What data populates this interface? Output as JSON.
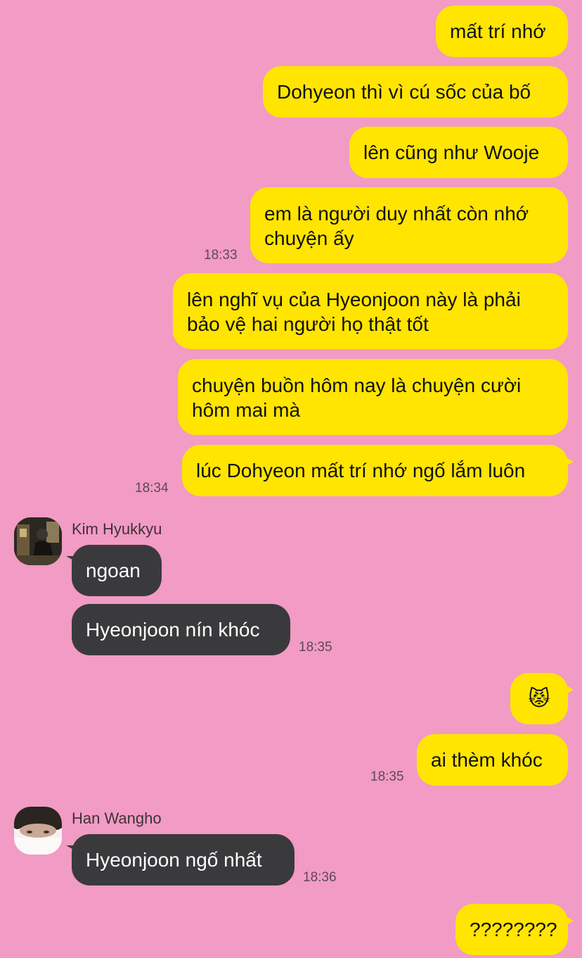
{
  "colors": {
    "background": "#f29bc4",
    "sent_bubble": "#ffe500",
    "received_bubble": "#3a3a3c",
    "timestamp": "#5b4a54"
  },
  "messages": [
    {
      "text": "mất trí nhớ"
    },
    {
      "text": "Dohyeon thì vì cú sốc của bố"
    },
    {
      "text": "lên cũng như Wooje"
    },
    {
      "line1": "em là người duy nhất còn nhớ",
      "line2": "chuyện ấy",
      "time": "18:33"
    },
    {
      "line1": "lên nghĩ vụ của Hyeonjoon này là phải",
      "line2": "bảo vệ hai người họ thật tốt"
    },
    {
      "line1": "chuyện buồn hôm nay là chuyện cười",
      "line2": "hôm mai mà"
    },
    {
      "text": "lúc Dohyeon mất trí nhớ ngố lắm luôn",
      "time": "18:34"
    }
  ],
  "kim": {
    "name": "Kim Hyukkyu",
    "avatar_icon": "profile-photo-dark",
    "msg1": "ngoan",
    "msg2": "Hyeonjoon nín khóc",
    "time": "18:35"
  },
  "me2": {
    "emoji_icon": "angry-cat-emoji",
    "emoji_glyph": "😾",
    "msg": "ai thèm khóc",
    "time": "18:35"
  },
  "han": {
    "name": "Han Wangho",
    "avatar_icon": "profile-photo-light",
    "msg": "Hyeonjoon ngố nhất",
    "time": "18:36"
  },
  "me3": {
    "msg": "????????"
  }
}
